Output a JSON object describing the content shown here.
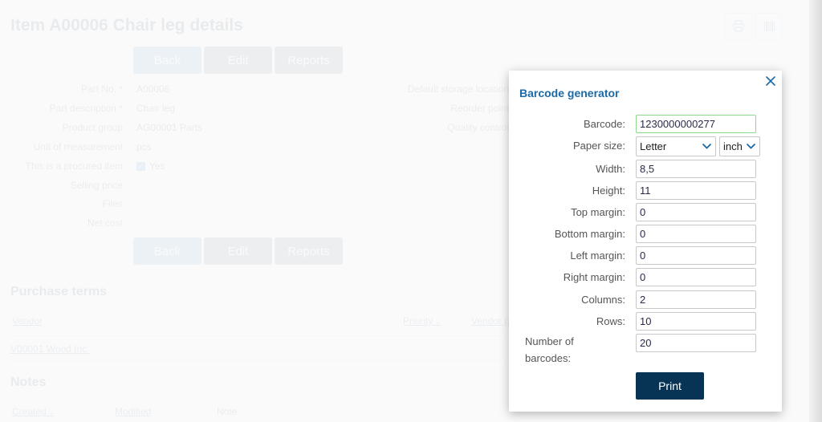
{
  "page": {
    "title": "Item A00006 Chair leg details",
    "top_icons": [
      "printer-icon",
      "barcode-icon"
    ],
    "buttons": {
      "back": "Back",
      "edit": "Edit",
      "reports": "Reports"
    },
    "fields": [
      {
        "label": "Part No. *",
        "value": "A00006"
      },
      {
        "label": "Part description *",
        "value": "Chair leg"
      },
      {
        "label": "Product group",
        "value": "AG00001 Parts"
      },
      {
        "label": "Unit of measurement",
        "value": "pcs"
      },
      {
        "label": "This is a procured item",
        "value": "Yes",
        "checked": true
      },
      {
        "label": "Selling price",
        "value": ""
      },
      {
        "label": "Files",
        "value": ""
      },
      {
        "label": "Net cost",
        "value": ""
      }
    ],
    "right_fields": [
      {
        "label": "Default storage location"
      },
      {
        "label": "Reorder point"
      },
      {
        "label": "Quality control"
      }
    ],
    "purchase_terms": {
      "title": "Purchase terms",
      "headers": {
        "vendor": "Vendor",
        "priority": "Priority",
        "vendor_p": "Vendor p"
      },
      "rows": [
        {
          "vendor": "V00001 Wood Inc."
        }
      ]
    },
    "notes": {
      "title": "Notes",
      "headers": {
        "created": "Created",
        "modified": "Modified",
        "note": "Note"
      }
    }
  },
  "modal": {
    "title": "Barcode generator",
    "close_icon": "close-icon",
    "fields": {
      "barcode": {
        "label": "Barcode:",
        "value": "1230000000277"
      },
      "paper_size": {
        "label": "Paper size:",
        "value": "Letter",
        "unit": "inch"
      },
      "width": {
        "label": "Width:",
        "value": "8,5"
      },
      "height": {
        "label": "Height:",
        "value": "11"
      },
      "top_margin": {
        "label": "Top margin:",
        "value": "0"
      },
      "bottom_margin": {
        "label": "Bottom margin:",
        "value": "0"
      },
      "left_margin": {
        "label": "Left margin:",
        "value": "0"
      },
      "right_margin": {
        "label": "Right margin:",
        "value": "0"
      },
      "columns": {
        "label": "Columns:",
        "value": "2"
      },
      "rows": {
        "label": "Rows:",
        "value": "10"
      },
      "number_of_barcodes": {
        "label": "Number of barcodes:",
        "value": "20"
      }
    },
    "print_label": "Print"
  }
}
